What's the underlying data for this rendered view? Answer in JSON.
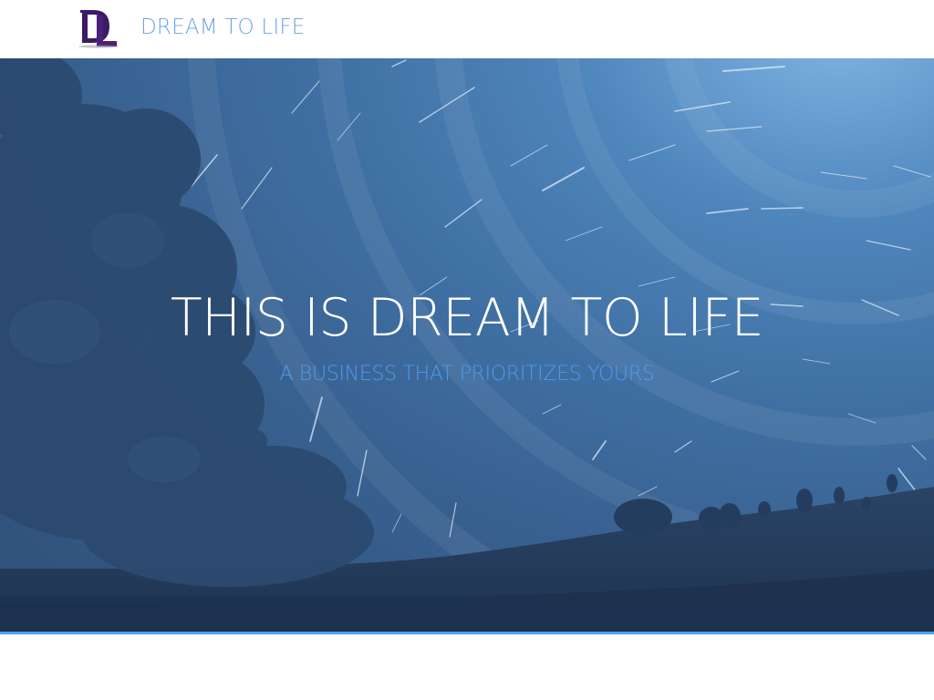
{
  "navbar": {
    "logo_icon": "dl-monogram-logo",
    "logo_text": "DL",
    "brand_name": "DREAM TO LIFE"
  },
  "hero": {
    "title": "THIS IS DREAM TO LIFE",
    "subtitle": "A BUSINESS THAT PRIORITIZES YOURS",
    "background_image": "night-sky-star-trails-with-trees"
  },
  "colors": {
    "brand_text": "#6ba4e6",
    "logo_purple": "#3c1a66",
    "hero_subtitle": "#4d9bf0",
    "hero_title": "#ffffff",
    "accent_line": "#4aa3f0"
  }
}
